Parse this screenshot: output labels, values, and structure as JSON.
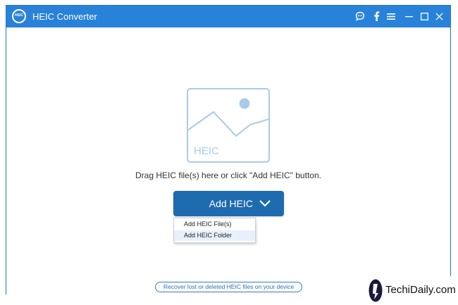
{
  "app": {
    "title": "HEIC Converter",
    "logo_text": "HEIC"
  },
  "titlebar_icons": [
    "feedback-icon",
    "facebook-icon",
    "menu-icon",
    "minimize-icon",
    "maximize-icon",
    "close-icon"
  ],
  "main": {
    "placeholder_label": "HEIC",
    "drop_hint": "Drag HEIC file(s) here or click \"Add HEIC\" button.",
    "add_button_label": "Add HEIC",
    "dropdown": {
      "items": [
        "Add HEIC File(s)",
        "Add HEIC Folder"
      ]
    }
  },
  "footer": {
    "recover_link": "Recover lost or deleted HEIC files on your device"
  },
  "watermark": {
    "text": "TechiDaily.com"
  },
  "colors": {
    "titlebar": "#2882d9",
    "button": "#1e6bb0",
    "placeholder_art": "#a9cbe9"
  }
}
